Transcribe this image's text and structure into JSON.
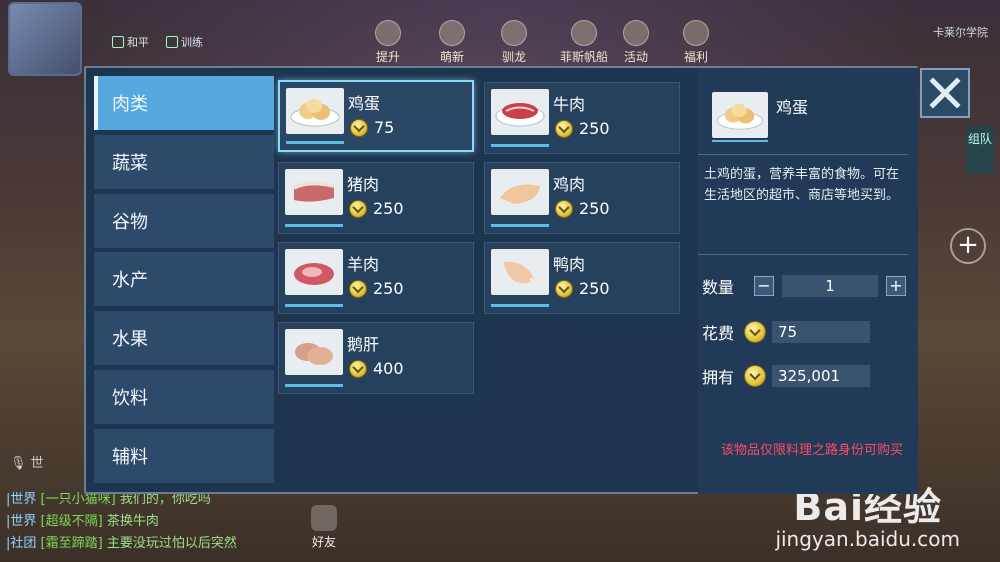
{
  "background": {
    "chat_buttons": [
      "和平",
      "训练"
    ],
    "top_icons": [
      "提升",
      "萌新",
      "驯龙",
      "菲斯帆船",
      "活动",
      "福利"
    ],
    "top_right_text": "卡莱尔学院",
    "side_button": "组队",
    "chat_channel_label": "世",
    "friend_label": "好友",
    "chat_lines": [
      {
        "channel": "世界",
        "who": "一只小猫咪",
        "msg": "我们的，你吃吗"
      },
      {
        "channel": "世界",
        "who": "超级不隔",
        "msg": "茶换牛肉"
      },
      {
        "channel": "社团",
        "who": "霜至蹄踏",
        "msg": "主要没玩过怕以后突然"
      }
    ],
    "watermark_logo": "Bai经验",
    "watermark_url": "jingyan.baidu.com"
  },
  "shop": {
    "categories": [
      "肉类",
      "蔬菜",
      "谷物",
      "水产",
      "水果",
      "饮料",
      "辅料"
    ],
    "active_category": "肉类",
    "items": [
      {
        "name": "鸡蛋",
        "price": "75",
        "icon": "egg-icon"
      },
      {
        "name": "牛肉",
        "price": "250",
        "icon": "beef-icon"
      },
      {
        "name": "猪肉",
        "price": "250",
        "icon": "pork-icon"
      },
      {
        "name": "鸡肉",
        "price": "250",
        "icon": "chicken-icon"
      },
      {
        "name": "羊肉",
        "price": "250",
        "icon": "mutton-icon"
      },
      {
        "name": "鸭肉",
        "price": "250",
        "icon": "duck-icon"
      },
      {
        "name": "鹅肝",
        "price": "400",
        "icon": "goose-liver-icon"
      }
    ],
    "selected_item": "鸡蛋",
    "detail": {
      "name": "鸡蛋",
      "description": "土鸡的蛋，营养丰富的食物。可在生活地区的超市、商店等地买到。",
      "qty_label": "数量",
      "qty_value": "1",
      "minus": "−",
      "plus": "+",
      "cost_label": "花费",
      "cost_value": "75",
      "own_label": "拥有",
      "own_value": "325,001",
      "warning": "该物品仅限料理之路身份可购买"
    }
  },
  "colors": {
    "panel": "#1e3550",
    "active_tab": "#56a9de",
    "selection_border": "#8fd8f5",
    "warning": "#ff4d62",
    "coin": "#e2c23a"
  }
}
